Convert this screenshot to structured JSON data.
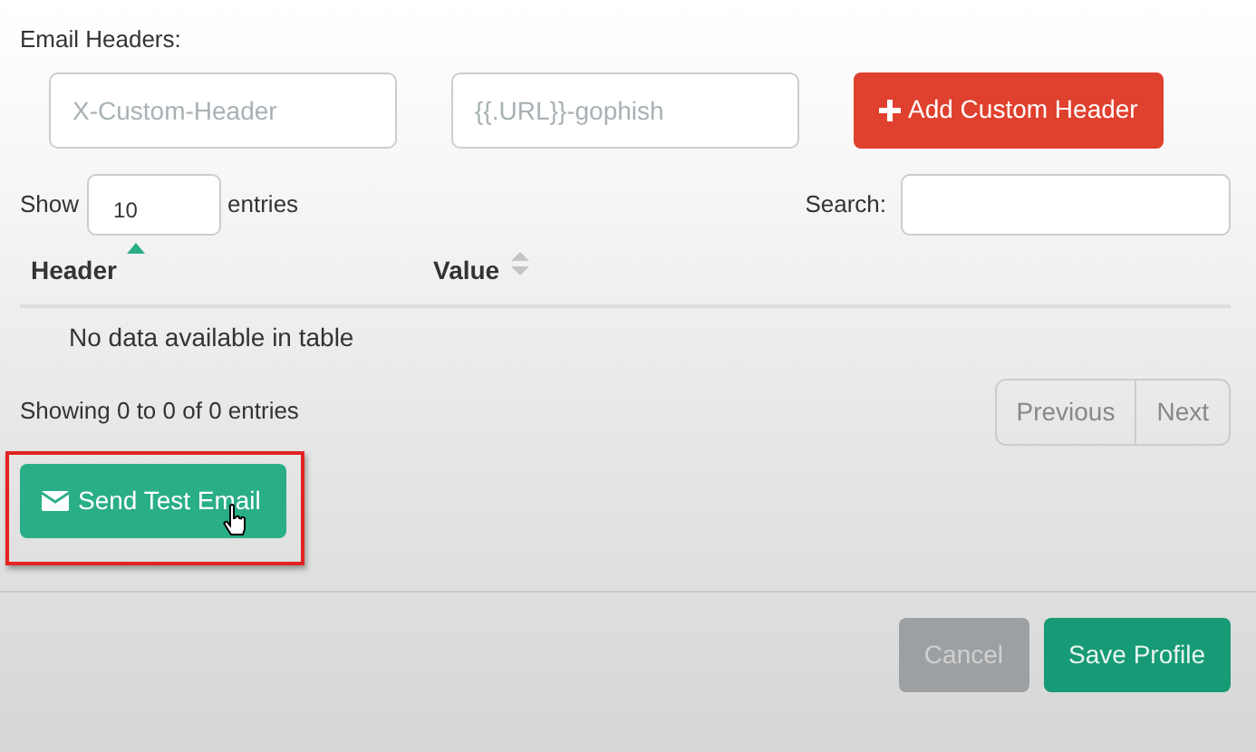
{
  "section_label": "Email Headers:",
  "header_form": {
    "name_placeholder": "X-Custom-Header",
    "value_placeholder": "{{.URL}}-gophish",
    "add_button": "Add Custom Header"
  },
  "length_menu": {
    "before": "Show",
    "value": "10",
    "after": "entries"
  },
  "search": {
    "label": "Search:"
  },
  "table": {
    "columns": [
      {
        "label": "Header",
        "sorted": true
      },
      {
        "label": "Value",
        "sorted": false
      }
    ],
    "empty_message": "No data available in table"
  },
  "info": "Showing 0 to 0 of 0 entries",
  "pagination": [
    {
      "label": "Previous"
    },
    {
      "label": "Next"
    }
  ],
  "test_button": {
    "label": "Send Test Email",
    "highlighted": true
  },
  "footer_buttons": [
    {
      "label": "Cancel",
      "kind": "secondary"
    },
    {
      "label": "Save Profile",
      "kind": "primary"
    }
  ]
}
